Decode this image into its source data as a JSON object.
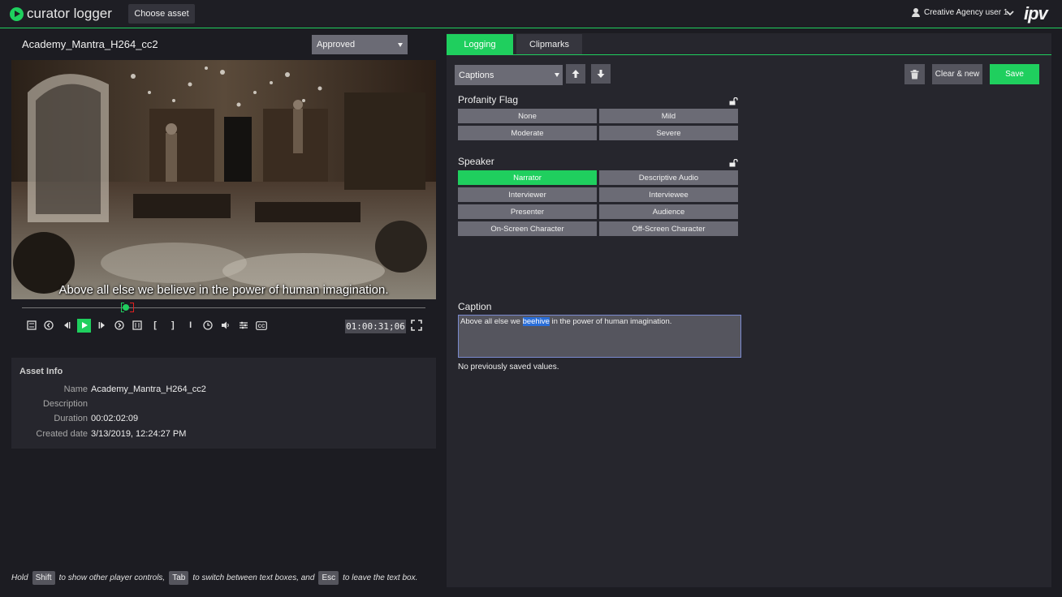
{
  "app": {
    "name": "curator logger",
    "choose_asset": "Choose asset",
    "user": "Creative Agency user 1",
    "brand": "ipv"
  },
  "asset": {
    "title": "Academy_Mantra_H264_cc2",
    "status": "Approved"
  },
  "player": {
    "subtitle": "Above all else we believe in the power of human imagination.",
    "timecode": "01:00:31;06",
    "controls": [
      "frame-back-icon",
      "prev-icon",
      "step-back-icon",
      "play-icon",
      "step-forward-icon",
      "next-icon",
      "frame-forward-icon",
      "mark-in-icon",
      "mark-out-icon",
      "clip-icon",
      "clock-icon",
      "volume-icon",
      "settings-icon",
      "cc-icon"
    ]
  },
  "asset_info": {
    "header": "Asset Info",
    "rows": [
      {
        "key": "Name",
        "value": "Academy_Mantra_H264_cc2"
      },
      {
        "key": "Description",
        "value": ""
      },
      {
        "key": "Duration",
        "value": "00:02:02:09"
      },
      {
        "key": "Created date",
        "value": "3/13/2019, 12:24:27 PM"
      }
    ]
  },
  "hint": {
    "hold": "Hold",
    "shift": "Shift",
    "show": "to show other player controls,",
    "tab": "Tab",
    "switch": "to switch between text boxes, and",
    "esc": "Esc",
    "leave": "to leave the text box."
  },
  "tabs": {
    "logging": "Logging",
    "clipmarks": "Clipmarks"
  },
  "toolbar": {
    "category": "Captions",
    "clear_new": "Clear & new",
    "save": "Save"
  },
  "profanity": {
    "title": "Profanity Flag",
    "options": [
      "None",
      "Mild",
      "Moderate",
      "Severe"
    ]
  },
  "speaker": {
    "title": "Speaker",
    "selected": "Narrator",
    "options": [
      "Narrator",
      "Descriptive Audio",
      "Interviewer",
      "Interviewee",
      "Presenter",
      "Audience",
      "On-Screen Character",
      "Off-Screen Character"
    ]
  },
  "caption": {
    "title": "Caption",
    "before": "Above all else we ",
    "highlight": "beehive",
    "after": " in the power of human imagination.",
    "note": "No previously saved values."
  },
  "colors": {
    "accent": "#1fcf5e",
    "panel": "#26262d",
    "button": "#6b6b75"
  }
}
